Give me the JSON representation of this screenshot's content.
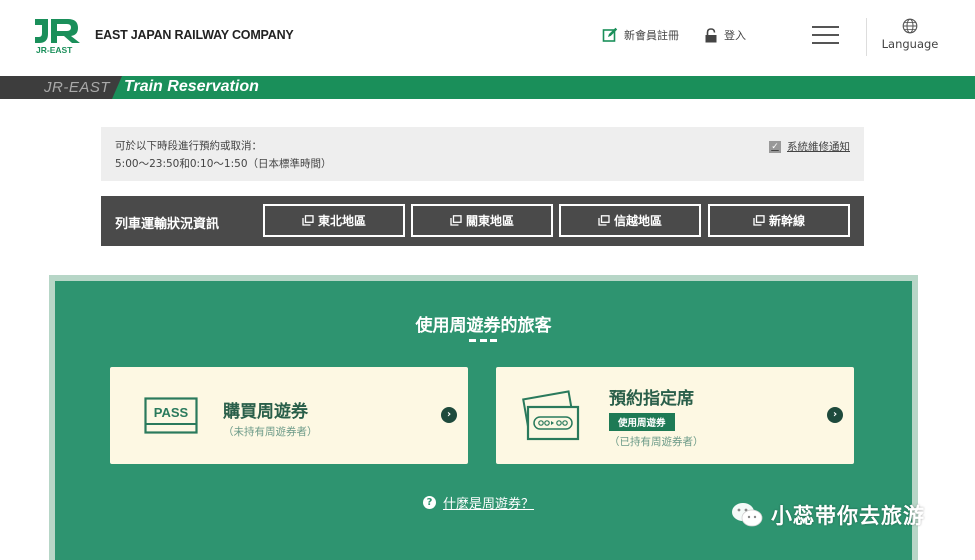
{
  "header": {
    "logo_text": "JR-EAST",
    "company_name": "EAST JAPAN RAILWAY COMPANY",
    "register_label": "新會員註冊",
    "login_label": "登入",
    "language_label": "Language"
  },
  "titlebar": {
    "brand": "JR-EAST",
    "title": "Train Reservation"
  },
  "notice": {
    "line1": "可於以下時段進行預約或取消：",
    "line2": "5:00～23:50和0:10～1:50（日本標準時間）",
    "maintenance_link": "系統維修通知"
  },
  "operation_status": {
    "title": "列車運輸狀況資訊",
    "regions": [
      "東北地區",
      "關東地區",
      "信越地區",
      "新幹線"
    ]
  },
  "pass_section": {
    "title": "使用周遊券的旅客",
    "buy": {
      "icon_text": "PASS",
      "title": "購買周遊券",
      "subtitle": "（未持有周遊券者）"
    },
    "reserve": {
      "title": "預約指定席",
      "badge": "使用周遊券",
      "subtitle": "（已持有周遊券者）"
    },
    "faq": "什麼是周遊券？"
  },
  "watermark": "小蕊带你去旅游",
  "colors": {
    "brand_green": "#1a8f5a",
    "panel_green": "#2e9470",
    "card_bg": "#fdf8e3",
    "status_bar": "#4a4a4a"
  }
}
